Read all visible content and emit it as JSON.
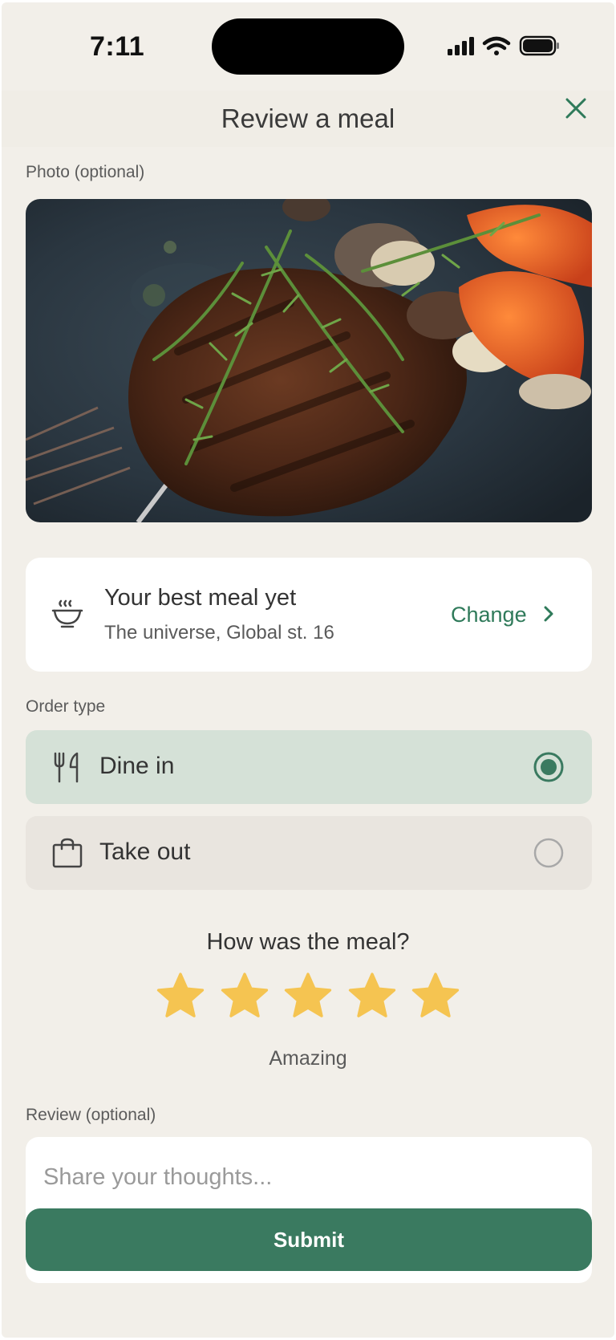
{
  "status_bar": {
    "time": "7:11"
  },
  "header": {
    "title": "Review a meal",
    "close_icon": "close-icon"
  },
  "photo": {
    "label": "Photo (optional)",
    "description_icon": "meal-photo"
  },
  "restaurant": {
    "icon": "steaming-bowl-icon",
    "name": "Your best meal yet",
    "address": "The universe, Global st. 16",
    "change_label": "Change"
  },
  "order_type": {
    "label": "Order type",
    "options": [
      {
        "label": "Dine in",
        "icon": "fork-knife-icon",
        "selected": true
      },
      {
        "label": "Take out",
        "icon": "shopping-bag-icon",
        "selected": false
      }
    ]
  },
  "rating": {
    "question": "How was the meal?",
    "stars": 5,
    "max_stars": 5,
    "text": "Amazing"
  },
  "review": {
    "label": "Review (optional)",
    "placeholder": "Share your thoughts...",
    "value": ""
  },
  "submit_label": "Submit",
  "colors": {
    "background": "#f2efe9",
    "accent": "#3a7a60",
    "selected_option": "#d5e1d7",
    "unselected_option": "#e9e5df",
    "star": "#f5c451"
  }
}
